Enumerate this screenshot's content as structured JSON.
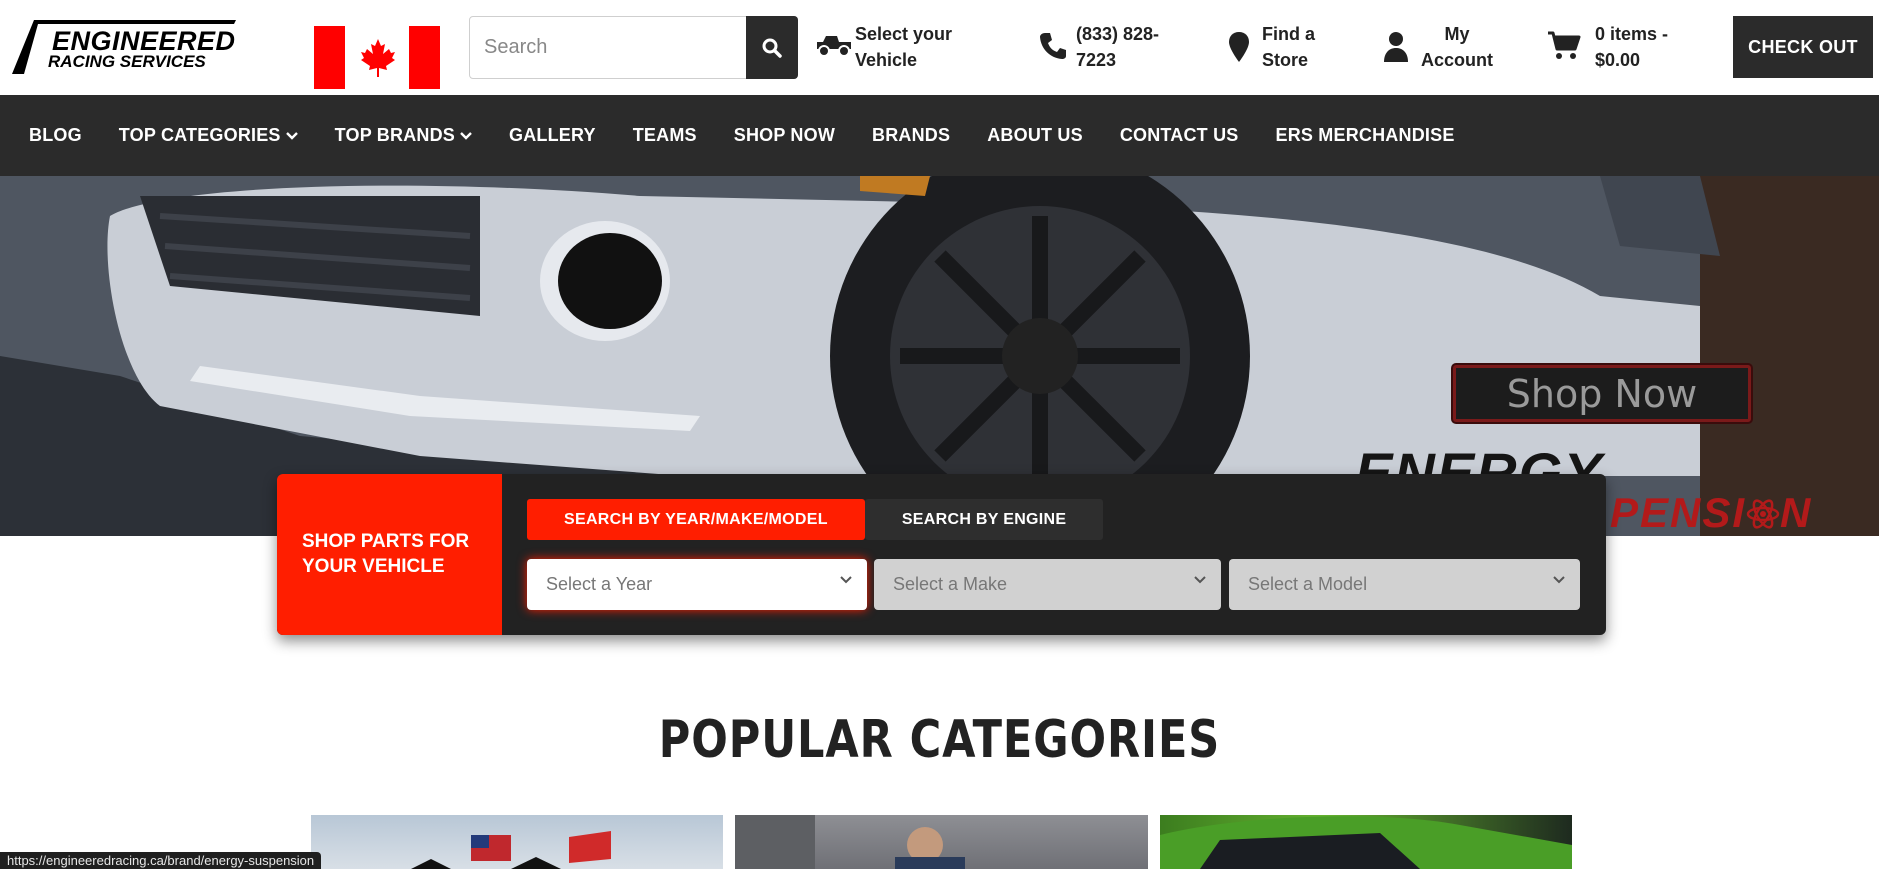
{
  "header": {
    "logo_line1": "ENGINEERED",
    "logo_line2": "RACING SERVICES",
    "search_placeholder": "Search",
    "vehicle_label": "Select your\nVehicle",
    "phone_label": "(833) 828-\n7223",
    "store_label": "Find a\nStore",
    "account_label": "My\nAccount",
    "cart_label": "0 items -\n$0.00",
    "checkout_label": "CHECK OUT",
    "flag": "canada-flag",
    "accent_color": "#ff1e00",
    "dark_color": "#2b2b2b"
  },
  "nav": {
    "items": [
      {
        "label": "BLOG"
      },
      {
        "label": "TOP CATEGORIES",
        "dropdown": true
      },
      {
        "label": "TOP BRANDS",
        "dropdown": true
      },
      {
        "label": "GALLERY"
      },
      {
        "label": "TEAMS"
      },
      {
        "label": "SHOP NOW"
      },
      {
        "label": "BRANDS"
      },
      {
        "label": "ABOUT US"
      },
      {
        "label": "CONTACT US"
      },
      {
        "label": "ERS MERCHANDISE"
      }
    ]
  },
  "hero": {
    "cta_label": "Shop Now",
    "brand_text_dark": "ENERGY",
    "brand_text_red": "PENSI",
    "brand_text_red_tail": "N"
  },
  "finder": {
    "label": "SHOP PARTS FOR\nYOUR VEHICLE",
    "tabs": [
      {
        "label": "SEARCH BY YEAR/MAKE/MODEL",
        "active": true
      },
      {
        "label": "SEARCH BY ENGINE",
        "active": false
      }
    ],
    "year_placeholder": "Select a Year",
    "make_placeholder": "Select a Make",
    "model_placeholder": "Select a Model"
  },
  "popular": {
    "heading": "POPULAR CATEGORIES"
  },
  "status_bar": {
    "url": "https://engineeredracing.ca/brand/energy-suspension"
  }
}
